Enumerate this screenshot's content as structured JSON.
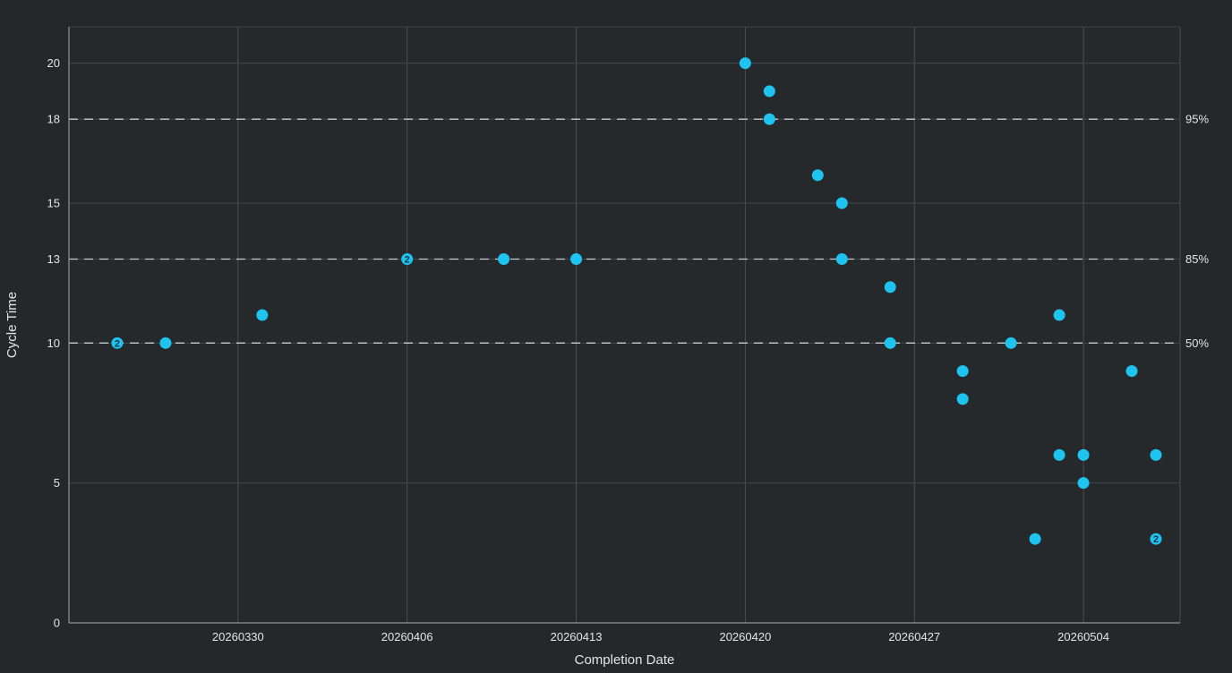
{
  "chart_data": {
    "type": "scatter",
    "xlabel": "Completion Date",
    "ylabel": "Cycle Time",
    "x_axis_type": "date",
    "xlim": [
      "20260323",
      "20260508"
    ],
    "ylim": [
      0,
      21.3
    ],
    "x_ticks": [
      "20260330",
      "20260406",
      "20260413",
      "20260420",
      "20260427",
      "20260504"
    ],
    "y_ticks": [
      0,
      5,
      10,
      13,
      15,
      18,
      20
    ],
    "grid": true,
    "point_color": "#1ec3f0",
    "percentile_lines": [
      {
        "label": "50%",
        "value": 10
      },
      {
        "label": "85%",
        "value": 13
      },
      {
        "label": "95%",
        "value": 18
      }
    ],
    "points": [
      {
        "x": "20260325",
        "y": 10,
        "count": 2
      },
      {
        "x": "20260327",
        "y": 10,
        "count": 1
      },
      {
        "x": "20260331",
        "y": 11,
        "count": 1
      },
      {
        "x": "20260406",
        "y": 13,
        "count": 2
      },
      {
        "x": "20260410",
        "y": 13,
        "count": 1
      },
      {
        "x": "20260413",
        "y": 13,
        "count": 1
      },
      {
        "x": "20260420",
        "y": 20,
        "count": 1
      },
      {
        "x": "20260421",
        "y": 19,
        "count": 1
      },
      {
        "x": "20260421",
        "y": 18,
        "count": 1
      },
      {
        "x": "20260423",
        "y": 16,
        "count": 1
      },
      {
        "x": "20260424",
        "y": 15,
        "count": 1
      },
      {
        "x": "20260424",
        "y": 13,
        "count": 1
      },
      {
        "x": "20260426",
        "y": 12,
        "count": 1
      },
      {
        "x": "20260426",
        "y": 10,
        "count": 1
      },
      {
        "x": "20260429",
        "y": 9,
        "count": 1
      },
      {
        "x": "20260429",
        "y": 8,
        "count": 1
      },
      {
        "x": "20260501",
        "y": 10,
        "count": 1
      },
      {
        "x": "20260502",
        "y": 3,
        "count": 1
      },
      {
        "x": "20260503",
        "y": 11,
        "count": 1
      },
      {
        "x": "20260503",
        "y": 6,
        "count": 1
      },
      {
        "x": "20260504",
        "y": 6,
        "count": 1
      },
      {
        "x": "20260504",
        "y": 5,
        "count": 1
      },
      {
        "x": "20260506",
        "y": 9,
        "count": 1
      },
      {
        "x": "20260507",
        "y": 6,
        "count": 1
      },
      {
        "x": "20260507",
        "y": 3,
        "count": 2
      }
    ]
  }
}
